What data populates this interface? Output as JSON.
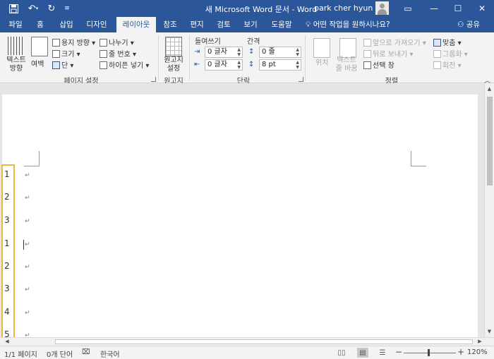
{
  "titlebar": {
    "title": "새 Microsoft Word 문서 - Word",
    "user": "park cher hyun",
    "quick_icons": [
      "save-icon",
      "undo-icon",
      "redo-icon",
      "customize-icon"
    ],
    "controls": {
      "ribbon_display": "▭",
      "minimize": "—",
      "maximize": "☐",
      "close": "✕"
    }
  },
  "tabs": [
    {
      "label": "파일"
    },
    {
      "label": "홈"
    },
    {
      "label": "삽입"
    },
    {
      "label": "디자인"
    },
    {
      "label": "레이아웃",
      "active": true
    },
    {
      "label": "참조"
    },
    {
      "label": "편지"
    },
    {
      "label": "검토"
    },
    {
      "label": "보기"
    },
    {
      "label": "도움말"
    }
  ],
  "tell_me": "어떤 작업을 원하시나요?",
  "share": "공유",
  "ribbon": {
    "page_setup": {
      "text_direction": "텍스트\n방향",
      "margins": "여백",
      "orientation": "용지 방향",
      "size": "크기",
      "columns": "단",
      "breaks": "나누기",
      "line_numbers": "줄 번호",
      "hyphenation": "하이픈 넣기",
      "label": "페이지 설정"
    },
    "manuscript": {
      "button": "원고지\n설정",
      "label": "원고지"
    },
    "paragraph": {
      "indent_header": "들여쓰기",
      "spacing_header": "간격",
      "indent_left": "0 글자",
      "indent_right": "0 글자",
      "spacing_before": "0 줄",
      "spacing_after": "8 pt",
      "label": "단락"
    },
    "arrange": {
      "position": "위치",
      "wrap_text": "텍스트\n줄 바꿈",
      "bring_forward": "앞으로 가져오기",
      "send_backward": "뒤로 보내기",
      "selection_pane": "선택 창",
      "align": "맞춤",
      "group": "그룹화",
      "rotate": "회전",
      "label": "정렬"
    }
  },
  "document": {
    "line_numbers": [
      "1",
      "2",
      "3",
      "1",
      "2",
      "3",
      "4",
      "5"
    ],
    "paragraph_mark": "↵",
    "highlight_color": "#e8b83c"
  },
  "status": {
    "page": "1/1 페이지",
    "words": "0개 단어",
    "language": "한국어",
    "zoom": "120%",
    "zoom_minus": "−",
    "zoom_plus": "+"
  },
  "colors": {
    "accent": "#2b579a"
  }
}
